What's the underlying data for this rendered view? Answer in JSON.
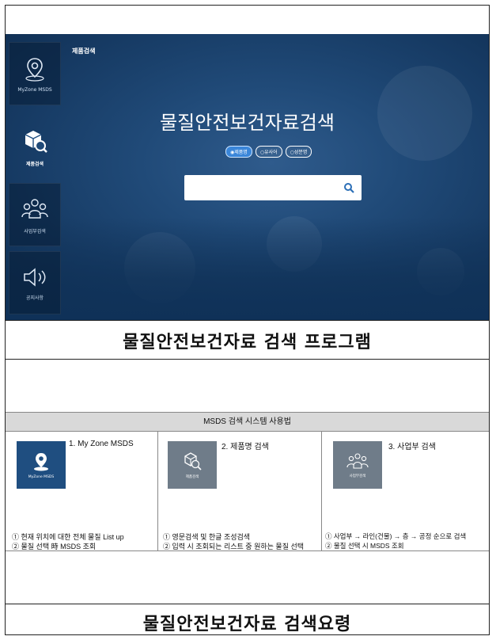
{
  "app": {
    "sidebar": [
      {
        "label": "MyZone MSDS",
        "icon": "map-pin-icon"
      },
      {
        "label": "제품검색",
        "icon": "cube-search-icon"
      },
      {
        "label": "사업부검색",
        "icon": "people-icon"
      },
      {
        "label": "공지사항",
        "icon": "speaker-icon"
      }
    ],
    "breadcrumb": "제품검색",
    "title": "물질안전보건자료검색",
    "radio_options": [
      "제품명",
      "유사어",
      "성분명"
    ],
    "selected_option": "제품명",
    "search_placeholder": ""
  },
  "caption_1": "물질안전보건자료 검색 프로그램",
  "guide": {
    "header": "MSDS 검색 시스템 사용법",
    "columns": [
      {
        "title": "1. My Zone MSDS",
        "thumb_label": "MyZone MSDS",
        "icon": "map-pin-icon",
        "lines": [
          "① 현재 위치에 대한 전체 물질 List up",
          "② 물질 선택 時 MSDS 조회"
        ]
      },
      {
        "title": "2. 제품명 검색",
        "thumb_label": "제품검색",
        "icon": "cube-search-icon",
        "lines": [
          "① 영문검색 및 한글 조성검색",
          "② 입력 시 조회되는 리스트 중 원하는 물질 선택"
        ]
      },
      {
        "title": "3. 사업부 검색",
        "thumb_label": "사업부검색",
        "icon": "people-icon",
        "lines": [
          "① 사업부 → 라인(건물) → 층 → 공정 순으로 검색",
          "② 물질 선택 시 MSDS 조회"
        ]
      }
    ]
  },
  "caption_2": "물질안전보건자료 검색요령",
  "colors": {
    "app_bg": "#204a78",
    "active_radio": "#3a86d9",
    "search_icon": "#2c6fb7"
  }
}
